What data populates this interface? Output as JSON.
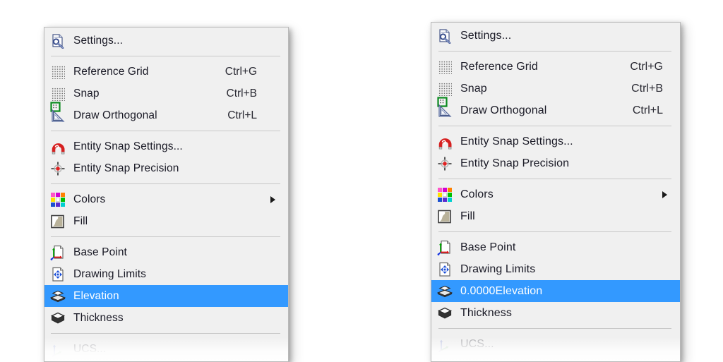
{
  "background_color": "#ffffff",
  "menu_background": "#f0f0f0",
  "highlight_color": "#3399ff",
  "highlight_text_color": "#ffffff",
  "text_color": "#1a1a26",
  "menus": [
    {
      "name": "left-context-menu",
      "groups": [
        {
          "items": [
            {
              "label": "Settings...",
              "accel": "",
              "icon": "settings-page-icon",
              "selected": false,
              "submenu": false,
              "faded": false
            }
          ]
        },
        {
          "items": [
            {
              "label": "Reference Grid",
              "accel": "Ctrl+G",
              "icon": "reference-grid-icon",
              "selected": false,
              "submenu": false,
              "faded": false
            },
            {
              "label": "Snap",
              "accel": "Ctrl+B",
              "icon": "snap-icon",
              "selected": false,
              "submenu": false,
              "faded": false
            },
            {
              "label": "Draw Orthogonal",
              "accel": "Ctrl+L",
              "icon": "draw-orthogonal-icon",
              "selected": false,
              "submenu": false,
              "faded": false
            }
          ]
        },
        {
          "items": [
            {
              "label": "Entity Snap Settings...",
              "accel": "",
              "icon": "magnet-icon",
              "selected": false,
              "submenu": false,
              "faded": false
            },
            {
              "label": "Entity Snap Precision",
              "accel": "",
              "icon": "crosshair-target-icon",
              "selected": false,
              "submenu": false,
              "faded": false
            }
          ]
        },
        {
          "items": [
            {
              "label": "Colors",
              "accel": "",
              "icon": "colors-palette-icon",
              "selected": false,
              "submenu": true,
              "faded": false
            },
            {
              "label": "Fill",
              "accel": "",
              "icon": "fill-icon",
              "selected": false,
              "submenu": false,
              "faded": false
            }
          ]
        },
        {
          "items": [
            {
              "label": "Base Point",
              "accel": "",
              "icon": "base-point-icon",
              "selected": false,
              "submenu": false,
              "faded": false
            },
            {
              "label": "Drawing Limits",
              "accel": "",
              "icon": "drawing-limits-icon",
              "selected": false,
              "submenu": false,
              "faded": false
            },
            {
              "label": "Elevation",
              "accel": "",
              "icon": "elevation-icon",
              "selected": true,
              "submenu": false,
              "faded": false
            },
            {
              "label": "Thickness",
              "accel": "",
              "icon": "thickness-icon",
              "selected": false,
              "submenu": false,
              "faded": false
            }
          ]
        },
        {
          "items": [
            {
              "label": "UCS...",
              "accel": "",
              "icon": "ucs-icon",
              "selected": false,
              "submenu": false,
              "faded": true
            }
          ]
        }
      ]
    },
    {
      "name": "right-context-menu",
      "groups": [
        {
          "items": [
            {
              "label": "Settings...",
              "accel": "",
              "icon": "settings-page-icon",
              "selected": false,
              "submenu": false,
              "faded": false
            }
          ]
        },
        {
          "items": [
            {
              "label": "Reference Grid",
              "accel": "Ctrl+G",
              "icon": "reference-grid-icon",
              "selected": false,
              "submenu": false,
              "faded": false
            },
            {
              "label": "Snap",
              "accel": "Ctrl+B",
              "icon": "snap-icon",
              "selected": false,
              "submenu": false,
              "faded": false
            },
            {
              "label": "Draw Orthogonal",
              "accel": "Ctrl+L",
              "icon": "draw-orthogonal-icon",
              "selected": false,
              "submenu": false,
              "faded": false
            }
          ]
        },
        {
          "items": [
            {
              "label": "Entity Snap Settings...",
              "accel": "",
              "icon": "magnet-icon",
              "selected": false,
              "submenu": false,
              "faded": false
            },
            {
              "label": "Entity Snap Precision",
              "accel": "",
              "icon": "crosshair-target-icon",
              "selected": false,
              "submenu": false,
              "faded": false
            }
          ]
        },
        {
          "items": [
            {
              "label": "Colors",
              "accel": "",
              "icon": "colors-palette-icon",
              "selected": false,
              "submenu": true,
              "faded": false
            },
            {
              "label": "Fill",
              "accel": "",
              "icon": "fill-icon",
              "selected": false,
              "submenu": false,
              "faded": false
            }
          ]
        },
        {
          "items": [
            {
              "label": "Base Point",
              "accel": "",
              "icon": "base-point-icon",
              "selected": false,
              "submenu": false,
              "faded": false
            },
            {
              "label": "Drawing Limits",
              "accel": "",
              "icon": "drawing-limits-icon",
              "selected": false,
              "submenu": false,
              "faded": false
            },
            {
              "label": "0.0000Elevation",
              "accel": "",
              "icon": "elevation-icon",
              "selected": true,
              "submenu": false,
              "faded": false
            },
            {
              "label": "Thickness",
              "accel": "",
              "icon": "thickness-icon",
              "selected": false,
              "submenu": false,
              "faded": false
            }
          ]
        },
        {
          "items": [
            {
              "label": "UCS...",
              "accel": "",
              "icon": "ucs-icon",
              "selected": false,
              "submenu": false,
              "faded": true
            }
          ]
        }
      ]
    }
  ]
}
